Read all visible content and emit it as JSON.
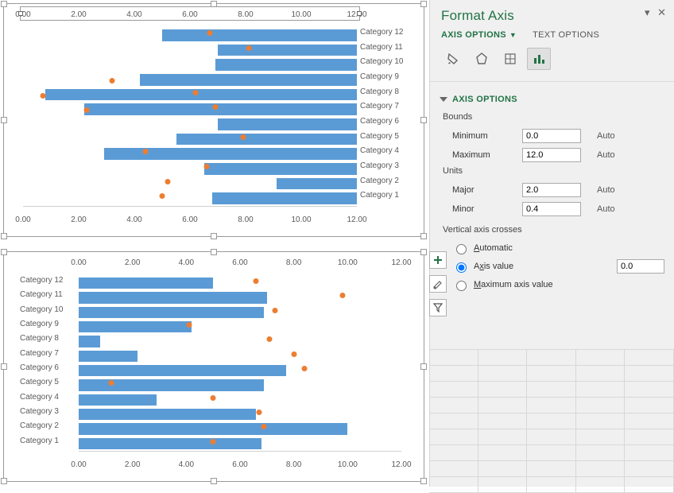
{
  "colors": {
    "bar": "#5b9bd5",
    "dot": "#ed7d31",
    "accent": "#217346"
  },
  "chart_data": [
    {
      "id": "chart-top",
      "type": "bar",
      "orientation": "horizontal",
      "xlim": [
        0,
        12
      ],
      "axes": [
        "top",
        "bottom"
      ],
      "ticks": [
        "0.00",
        "2.00",
        "4.00",
        "6.00",
        "8.00",
        "10.00",
        "12.00"
      ],
      "cat_side": "right",
      "reversed": true,
      "categories": [
        "Category 12",
        "Category 11",
        "Category 10",
        "Category 9",
        "Category 8",
        "Category 7",
        "Category 6",
        "Category 5",
        "Category 4",
        "Category 3",
        "Category 2",
        "Category 1"
      ],
      "bars": [
        {
          "start": 5.0,
          "end": 12.0
        },
        {
          "start": 7.0,
          "end": 12.0
        },
        {
          "start": 6.9,
          "end": 12.0
        },
        {
          "start": 4.2,
          "end": 12.0
        },
        {
          "start": 0.8,
          "end": 12.0
        },
        {
          "start": 2.2,
          "end": 12.0
        },
        {
          "start": 7.0,
          "end": 12.0
        },
        {
          "start": 5.5,
          "end": 12.0
        },
        {
          "start": 2.9,
          "end": 12.0
        },
        {
          "start": 6.5,
          "end": 12.0
        },
        {
          "start": 9.1,
          "end": 12.0
        },
        {
          "start": 6.8,
          "end": 12.0
        }
      ],
      "dots": [
        {
          "x": 6.7
        },
        {
          "x": 8.1
        },
        {
          "x": null
        },
        {
          "x": null
        },
        {
          "x": 6.2
        },
        {
          "x": 6.9
        },
        {
          "x": null
        },
        {
          "x": 7.9
        },
        {
          "x": 4.4
        },
        {
          "x": 6.6
        },
        {
          "x": 5.2
        },
        {
          "x": 5.0
        }
      ],
      "extra_dots": [
        {
          "row": 3,
          "x": 3.2
        },
        {
          "row": 4,
          "x": 0.7
        },
        {
          "row": 5,
          "x": 2.3
        }
      ],
      "selected_axis": "top"
    },
    {
      "id": "chart-bottom",
      "type": "bar",
      "orientation": "horizontal",
      "xlim": [
        0,
        12
      ],
      "axes": [
        "top",
        "bottom"
      ],
      "ticks": [
        "0.00",
        "2.00",
        "4.00",
        "6.00",
        "8.00",
        "10.00",
        "12.00"
      ],
      "cat_side": "left",
      "reversed": false,
      "categories": [
        "Category 12",
        "Category 11",
        "Category 10",
        "Category 9",
        "Category 8",
        "Category 7",
        "Category 6",
        "Category 5",
        "Category 4",
        "Category 3",
        "Category 2",
        "Category 1"
      ],
      "bars": [
        {
          "start": 0,
          "end": 5.0
        },
        {
          "start": 0,
          "end": 7.0
        },
        {
          "start": 0,
          "end": 6.9
        },
        {
          "start": 0,
          "end": 4.2
        },
        {
          "start": 0,
          "end": 0.8
        },
        {
          "start": 0,
          "end": 2.2
        },
        {
          "start": 0,
          "end": 7.7
        },
        {
          "start": 0,
          "end": 6.9
        },
        {
          "start": 0,
          "end": 2.9
        },
        {
          "start": 0,
          "end": 6.6
        },
        {
          "start": 0,
          "end": 10.0
        },
        {
          "start": 0,
          "end": 6.8
        }
      ],
      "dots": [
        {
          "x": 6.6
        },
        {
          "x": 9.8
        },
        {
          "x": 7.3
        },
        {
          "x": 4.1
        },
        {
          "x": 7.1
        },
        {
          "x": 8.0
        },
        {
          "x": 8.4
        },
        {
          "x": 1.2
        },
        {
          "x": 5.0
        },
        {
          "x": 6.7
        },
        {
          "x": 6.9
        },
        {
          "x": 5.0
        }
      ]
    }
  ],
  "pane": {
    "title": "Format Axis",
    "tab_axis": "AXIS OPTIONS",
    "tab_text": "TEXT OPTIONS",
    "section": "AXIS OPTIONS",
    "bounds_label": "Bounds",
    "min_label": "Minimum",
    "min_val": "0.0",
    "min_auto": "Auto",
    "max_label": "Maximum",
    "max_val": "12.0",
    "max_auto": "Auto",
    "units_label": "Units",
    "major_label": "Major",
    "major_val": "2.0",
    "major_auto": "Auto",
    "minor_label": "Minor",
    "minor_val": "0.4",
    "minor_auto": "Auto",
    "vc_label": "Vertical axis crosses",
    "vc_auto": "Automatic",
    "vc_auto_u": "A",
    "vc_val": "Axis value",
    "vc_val_u": "x",
    "vc_val_num": "0.0",
    "vc_max": "Maximum axis value",
    "vc_max_u": "M"
  },
  "side_buttons": [
    "plus",
    "brush",
    "funnel"
  ]
}
